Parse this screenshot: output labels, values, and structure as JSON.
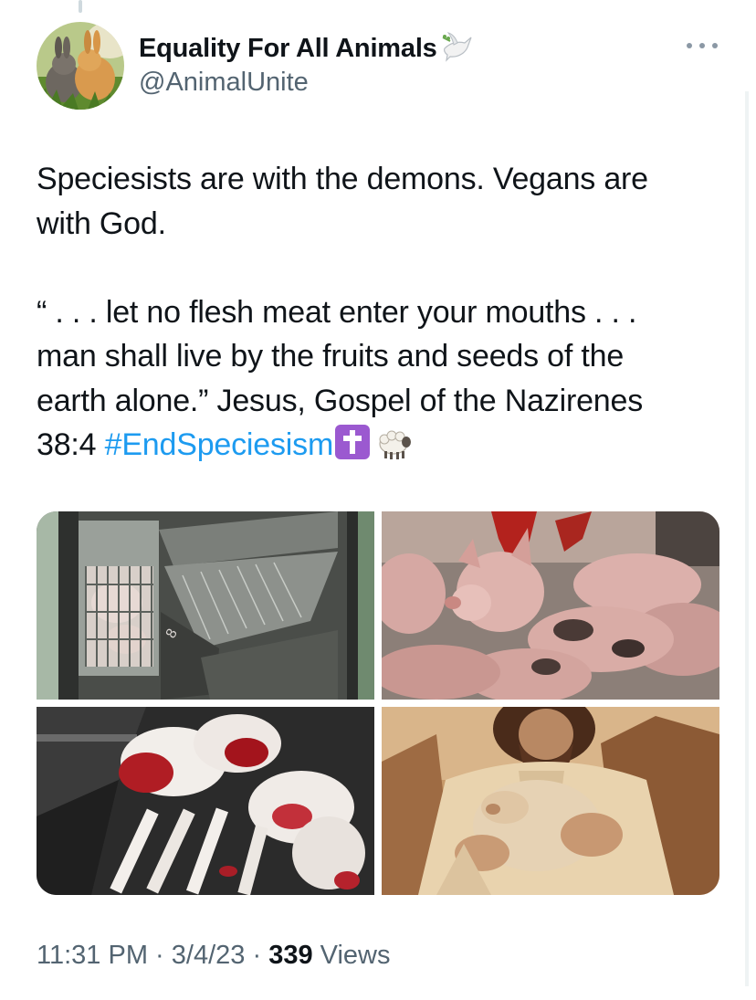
{
  "author": {
    "display_name": "Equality For All Animals",
    "handle": "@AnimalUnite",
    "name_emoji_icon": "dove-icon"
  },
  "tweet": {
    "line1": "Speciesists are with the demons. Vegans are",
    "line2": "with God.",
    "quote1": "“ . . . let no flesh meat enter your mouths . . .",
    "quote2": "man shall live by the fruits and seeds of the",
    "quote3": "earth alone.”  Jesus, Gospel of the Nazirenes",
    "ref": "38:4",
    "hashtag": "#EndSpeciesism",
    "emojis": [
      "latin-cross-icon",
      "sheep-icon"
    ]
  },
  "media": {
    "images": [
      "battery-cage-pigs-photo",
      "crowded-pigs-photo",
      "bloodied-lambs-photo",
      "jesus-holding-lamb-painting"
    ]
  },
  "meta": {
    "time": "11:31 PM",
    "sep1": " · ",
    "date": "3/4/23",
    "sep2": " · ",
    "views_count": "339",
    "views_label": " Views"
  },
  "colors": {
    "text": "#0f1419",
    "secondary": "#536471",
    "link": "#1d9bf0"
  }
}
